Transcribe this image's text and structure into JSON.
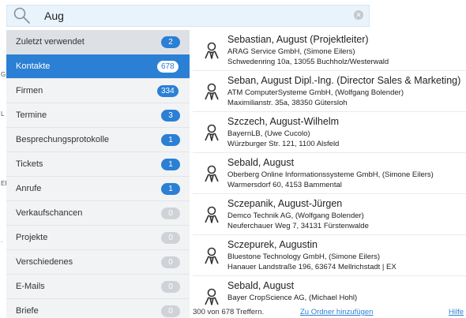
{
  "search": {
    "value": "Aug",
    "clear_icon": "clear-icon"
  },
  "categories": [
    {
      "label": "Zuletzt verwendet",
      "count": "2"
    },
    {
      "label": "Kontakte",
      "count": "678"
    },
    {
      "label": "Firmen",
      "count": "334"
    },
    {
      "label": "Termine",
      "count": "3"
    },
    {
      "label": "Besprechungsprotokolle",
      "count": "1"
    },
    {
      "label": "Tickets",
      "count": "1"
    },
    {
      "label": "Anrufe",
      "count": "1"
    },
    {
      "label": "Verkaufschancen",
      "count": "0"
    },
    {
      "label": "Projekte",
      "count": "0"
    },
    {
      "label": "Verschiedenes",
      "count": "0"
    },
    {
      "label": "E-Mails",
      "count": "0"
    },
    {
      "label": "Briefe",
      "count": "0"
    }
  ],
  "results": [
    {
      "name": "Sebastian, August (Projektleiter)",
      "company": "ARAG Service GmbH, (Simone Eilers)",
      "address": "Schwedenring 10a, 13055 Buchholz/Westerwald"
    },
    {
      "name": "Seban, August Dipl.-Ing. (Director Sales & Marketing)",
      "company": "ATM ComputerSysteme GmbH, (Wolfgang Bolender)",
      "address": "Maximilianstr. 35a, 38350 Gütersloh"
    },
    {
      "name": "Szczech, August-Wilhelm",
      "company": "BayernLB, (Uwe Cucolo)",
      "address": "Würzburger Str. 121, 1100 Alsfeld"
    },
    {
      "name": "Sebald, August",
      "company": "Oberberg Online Informationssysteme GmbH, (Simone Eilers)",
      "address": "Warmersdorf 60, 4153 Bammental"
    },
    {
      "name": "Sczepanik, August-Jürgen",
      "company": "Demco Technik AG, (Wolfgang Bolender)",
      "address": "Neuferchauer Weg 7, 34131 Fürstenwalde"
    },
    {
      "name": "Sczepurek, Augustin",
      "company": "Bluestone Technology GmbH, (Simone Eilers)",
      "address": "Hanauer Landstraße 196, 63674 Mellrichstadt | EX"
    },
    {
      "name": "Sebald, August",
      "company": "Bayer CropScience AG, (Michael Hohl)",
      "address": ""
    }
  ],
  "footer": {
    "count_text": "300 von 678 Treffern.",
    "add_link": "Zu Ordner hinzufügen",
    "help_link": "Hilfe"
  },
  "edge_marks": [
    "G",
    "L",
    "EF",
    "."
  ],
  "colors": {
    "accent": "#2b7fd4",
    "badge_zero": "#cfd3d7",
    "sidebar_bg": "#f1f3f5",
    "search_bg": "#e9f3fb"
  }
}
